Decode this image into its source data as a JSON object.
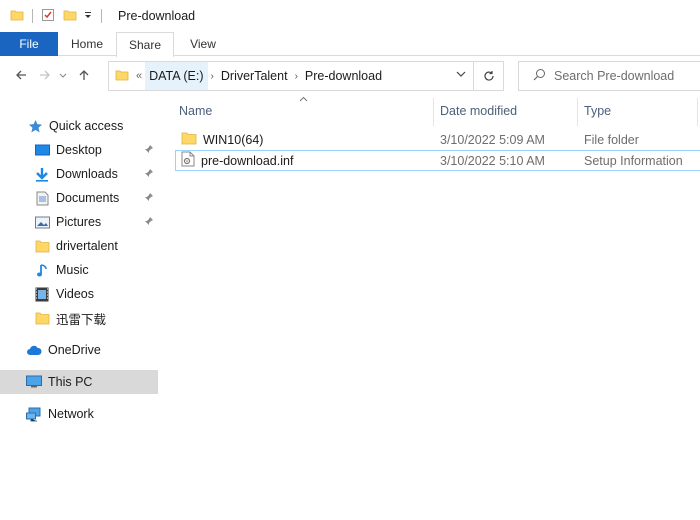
{
  "window": {
    "title": "Pre-download"
  },
  "ribbon": {
    "tabs": [
      {
        "label": "File"
      },
      {
        "label": "Home"
      },
      {
        "label": "Share"
      },
      {
        "label": "View"
      }
    ]
  },
  "address": {
    "overflow": "«",
    "crumbs": [
      "DATA (E:)",
      "DriverTalent",
      "Pre-download"
    ]
  },
  "search": {
    "placeholder": "Search Pre-download"
  },
  "sidebar": {
    "items": [
      {
        "label": "Quick access",
        "icon": "star-icon"
      },
      {
        "label": "Desktop",
        "icon": "desktop-icon",
        "pinned": true
      },
      {
        "label": "Downloads",
        "icon": "download-icon",
        "pinned": true
      },
      {
        "label": "Documents",
        "icon": "documents-icon",
        "pinned": true
      },
      {
        "label": "Pictures",
        "icon": "pictures-icon",
        "pinned": true
      },
      {
        "label": "drivertalent",
        "icon": "folder-icon"
      },
      {
        "label": "Music",
        "icon": "music-icon"
      },
      {
        "label": "Videos",
        "icon": "videos-icon"
      },
      {
        "label": "迅雷下载",
        "icon": "folder-icon"
      },
      {
        "label": "OneDrive",
        "icon": "cloud-icon"
      },
      {
        "label": "This PC",
        "icon": "computer-icon",
        "selected": true
      },
      {
        "label": "Network",
        "icon": "network-icon"
      }
    ]
  },
  "columns": {
    "name": "Name",
    "date": "Date modified",
    "type": "Type"
  },
  "files": [
    {
      "name": "WIN10(64)",
      "date": "3/10/2022 5:09 AM",
      "type": "File folder",
      "icon": "folder-icon"
    },
    {
      "name": "pre-download.inf",
      "date": "3/10/2022 5:10 AM",
      "type": "Setup Information",
      "icon": "inf-file-icon"
    }
  ],
  "colors": {
    "accent": "#1a65c0",
    "folder": "#ffd766",
    "selection": "#99d1ff"
  }
}
